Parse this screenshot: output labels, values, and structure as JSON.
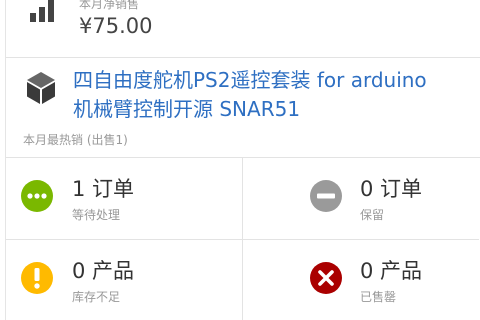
{
  "sales_card": {
    "label": "本月净销售",
    "value": "¥75.00",
    "icon": "bar-chart-icon"
  },
  "best_seller": {
    "icon": "box-icon",
    "product_line1": "四自由度舵机PS2遥控套装 for arduino",
    "product_line2": "机械臂控制开源 SNAR51",
    "caption": "本月最热销 (出售1)",
    "link_color": "#2e6fc2"
  },
  "stats": [
    {
      "count": "1 订单",
      "label": "等待处理",
      "icon": "ellipsis-circle-icon",
      "color": "#7ab800"
    },
    {
      "count": "0 订单",
      "label": "保留",
      "icon": "minus-circle-icon",
      "color": "#9a9a9a"
    },
    {
      "count": "0 产品",
      "label": "库存不足",
      "icon": "exclamation-circle-icon",
      "color": "#ffba00"
    },
    {
      "count": "0 产品",
      "label": "已售罄",
      "icon": "x-circle-icon",
      "color": "#aa0000"
    }
  ]
}
